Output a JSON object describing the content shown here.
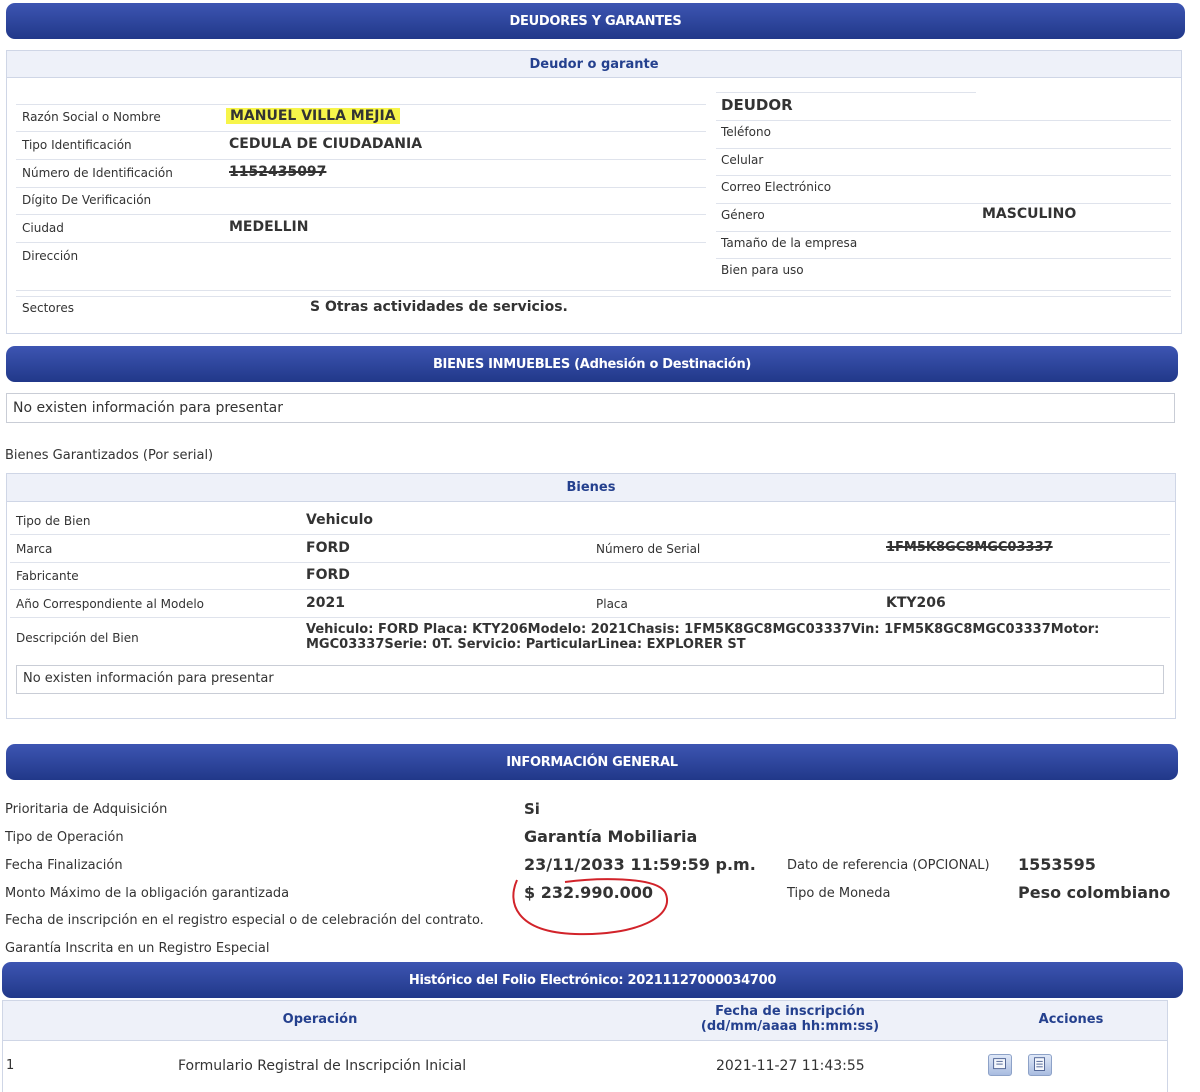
{
  "deudores": {
    "title": "DEUDORES Y GARANTES",
    "subtitle": "Deudor o garante",
    "left": [
      {
        "label": "Razón Social o Nombre",
        "value": "MANUEL VILLA MEJIA"
      },
      {
        "label": "Tipo Identificación",
        "value": "CEDULA DE CIUDADANIA"
      },
      {
        "label": "Número de Identificación",
        "value": "1152435097"
      },
      {
        "label": "Dígito De Verificación",
        "value": ""
      },
      {
        "label": "Ciudad",
        "value": "MEDELLIN"
      },
      {
        "label": "Dirección",
        "value": ""
      }
    ],
    "role": "DEUDOR",
    "right": [
      {
        "label": "Teléfono",
        "value": ""
      },
      {
        "label": "Celular",
        "value": ""
      },
      {
        "label": "Correo Electrónico",
        "value": ""
      },
      {
        "label": "Género",
        "value": "MASCULINO"
      },
      {
        "label": "Tamaño de la empresa",
        "value": ""
      },
      {
        "label": "Bien para uso",
        "value": ""
      }
    ],
    "sectores_label": "Sectores",
    "sectores_value": "S Otras actividades de servicios."
  },
  "inmuebles": {
    "title": "BIENES INMUEBLES (Adhesión o Destinación)",
    "no_data": "No existen información para presentar"
  },
  "bienes_garantizados_label": "Bienes Garantizados (Por serial)",
  "bienes": {
    "subtitle": "Bienes",
    "tipo_label": "Tipo de Bien",
    "tipo_value": "Vehiculo",
    "marca_label": "Marca",
    "marca_value": "FORD",
    "serial_label": "Número de Serial",
    "serial_value": "1FM5K8GC8MGC03337",
    "fabricante_label": "Fabricante",
    "fabricante_value": "FORD",
    "anio_label": "Año Correspondiente al Modelo",
    "anio_value": "2021",
    "placa_label": "Placa",
    "placa_value": "KTY206",
    "desc_label": "Descripción del Bien",
    "desc_line1": "Vehiculo: FORD Placa: KTY206Modelo: 2021Chasis: 1FM5K8GC8MGC03337Vin: 1FM5K8GC8MGC03337Motor:",
    "desc_line2": "MGC03337Serie: 0T. Servicio: ParticularLinea: EXPLORER ST",
    "no_data": "No existen información para presentar"
  },
  "general": {
    "title": "INFORMACIÓN GENERAL",
    "prioritaria_label": "Prioritaria de Adquisición",
    "prioritaria_value": "Si",
    "tipo_op_label": "Tipo de Operación",
    "tipo_op_value": "Garantía Mobiliaria",
    "fecha_fin_label": "Fecha Finalización",
    "fecha_fin_value": "23/11/2033 11:59:59 p.m.",
    "monto_label": "Monto Máximo de la obligación garantizada",
    "monto_value": "$ 232.990.000",
    "fecha_insc_label": "Fecha de inscripción en el registro especial o de celebración del contrato.",
    "garantia_label": "Garantía Inscrita en un Registro Especial",
    "dato_ref_label": "Dato de referencia (OPCIONAL)",
    "dato_ref_value": "1553595",
    "moneda_label": "Tipo de Moneda",
    "moneda_value": "Peso colombiano"
  },
  "historico": {
    "title": "Histórico del Folio Electrónico: 20211127000034700",
    "col_operacion": "Operación",
    "col_fecha_1": "Fecha de inscripción",
    "col_fecha_2": "(dd/mm/aaaa hh:mm:ss)",
    "col_acciones": "Acciones",
    "rows": [
      {
        "num": "1",
        "operacion": "Formulario Registral de Inscripción Inicial",
        "fecha": "2021-11-27 11:43:55"
      }
    ]
  },
  "colors": {
    "bar": "#2c4199",
    "subhead_bg": "#eef1f9",
    "highlight": "#f7f54a",
    "annotation": "#d2232a"
  }
}
